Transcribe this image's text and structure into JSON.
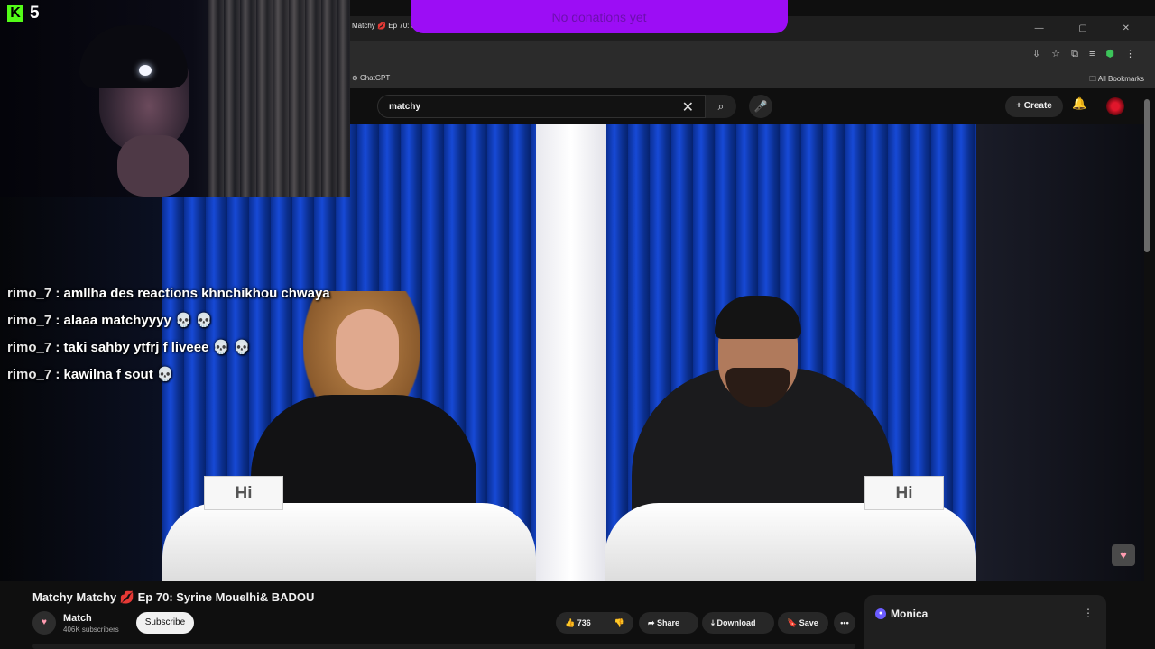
{
  "browser": {
    "tab_title": "Matchy",
    "tab_title_rest": "Ep 70: Sy",
    "tab_emoji": "💋",
    "window_controls": "— ▢ ✕",
    "bookmark_chatgpt": "ChatGPT",
    "bookmark_all": "All Bookmarks"
  },
  "youtube_header": {
    "search_value": "matchy",
    "clear_glyph": "✕",
    "search_glyph": "⌕",
    "mic_glyph": "🎤",
    "create_label": "Create",
    "create_glyph": "+",
    "bell_glyph": "🔔"
  },
  "stream_overlay": {
    "viewer_count": "5",
    "kick_letter": "K",
    "donation_text": "No donations yet"
  },
  "chat": [
    {
      "user": "rimo_7 :",
      "message": "amllha des reactions khnchikhou chwaya"
    },
    {
      "user": "rimo_7 :",
      "message": "alaaa matchyyyy 💀 💀"
    },
    {
      "user": "rimo_7 :",
      "message": "taki sahby ytfrj f liveee 💀 💀"
    },
    {
      "user": "rimo_7 :",
      "message": "kawilna f sout 💀"
    }
  ],
  "video_scene": {
    "card_left": "Hi",
    "card_right": "Hi"
  },
  "video": {
    "title_prefix": "Matchy Matchy",
    "title_emoji": "💋",
    "title_suffix": "Ep 70: Syrine Mouelhi& BADOU",
    "channel_name": "Match",
    "subscribers": "406K subscribers",
    "subscribe_label": "Subscribe",
    "likes": "736",
    "share_label": "Share",
    "download_label": "Download",
    "save_label": "Save",
    "more_glyph": "•••"
  },
  "sidepanel": {
    "label": "Monica",
    "menu_glyph": "⋮"
  },
  "icons": {
    "accent_purple": "#9c0df5",
    "kick_green": "#53fc18",
    "youtube_bg": "#0f0f0f"
  }
}
